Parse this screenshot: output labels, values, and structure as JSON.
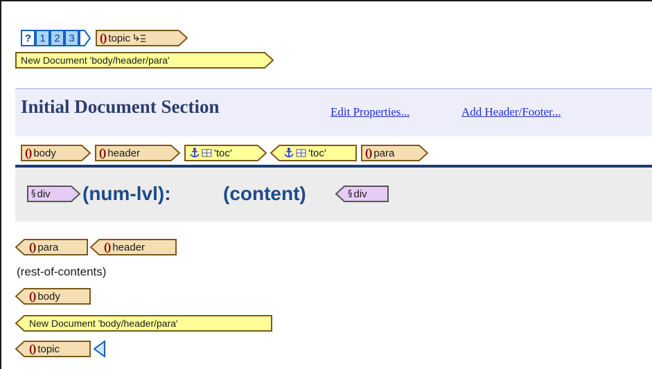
{
  "colors": {
    "tag_fill": "#f5deb3",
    "tag_border": "#7a5a1a",
    "yellow_fill": "#ffff99",
    "lavender_fill": "#e6ccf5",
    "section_band": "#eeeefa",
    "div_band": "#ececec",
    "link": "#1a2fd6",
    "rule": "#1e3a6e",
    "big_text": "#1a4b8f"
  },
  "toolbar": {
    "help_label": "?",
    "levels": [
      "1",
      "2",
      "3"
    ],
    "topic_label": "topic"
  },
  "template_bar": {
    "open_label": "New Document 'body/header/para'",
    "close_label": "New Document 'body/header/para'"
  },
  "section": {
    "title": "Initial Document Section",
    "edit_properties": "Edit Properties...",
    "add_header_footer": "Add Header/Footer..."
  },
  "path": {
    "body": "body",
    "header": "header",
    "toc_open": "'toc'",
    "toc_close": "'toc'",
    "para": "para"
  },
  "div_block": {
    "div_open": "div",
    "num_lvl": "(num-lvl):",
    "content": "(content)",
    "div_close": "div"
  },
  "closing": {
    "para": "para",
    "header": "header",
    "rest_text": "(rest-of-contents)",
    "body": "body",
    "topic": "topic"
  }
}
